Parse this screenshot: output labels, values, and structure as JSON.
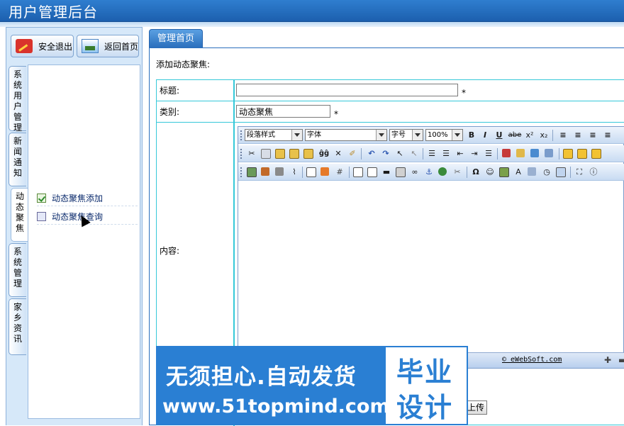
{
  "header": {
    "title": "用户管理后台"
  },
  "left": {
    "logout_label": "安全退出",
    "home_label": "返回首页",
    "vtabs": [
      "系统用户管理",
      "新闻通知",
      "动态聚焦",
      "系统管理",
      "家乡资讯"
    ],
    "active_tab": 2,
    "menu_items": [
      "动态聚焦添加",
      "动态聚焦查询"
    ]
  },
  "main": {
    "tab_label": "管理首页",
    "heading": "添加动态聚焦:",
    "form": {
      "title_label": "标题:",
      "title_value": "",
      "category_label": "类别:",
      "category_value": "动态聚焦",
      "content_label": "内容:",
      "required_mark": "*"
    },
    "editor": {
      "paragraph_style": "段落样式",
      "font": "字体",
      "font_size": "字号",
      "zoom": "100%",
      "brand": "© eWebSoft.com"
    },
    "upload_label": "上传"
  },
  "watermark": {
    "line1": "无须担心.自动发货",
    "line2": "www.51topmind.com",
    "box_line1": "毕业",
    "box_line2": "设计"
  }
}
